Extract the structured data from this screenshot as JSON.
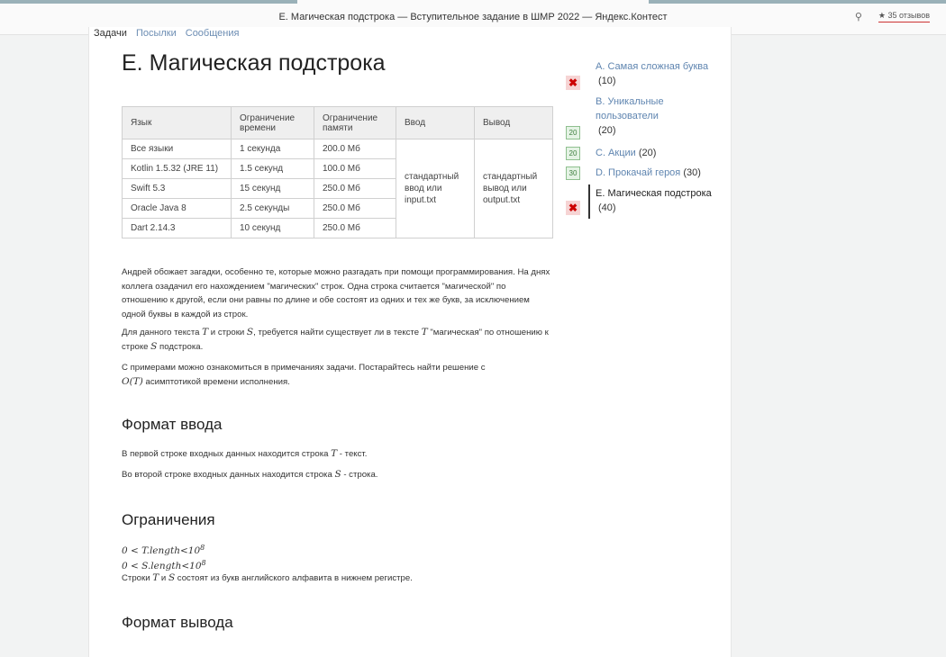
{
  "window": {
    "title": "E. Магическая подстрока — Вступительное задание в ШМР 2022 — Яндекс.Контест",
    "reviews": "★ 35 отзывов",
    "pin_icon": "pin-icon"
  },
  "nav": {
    "items": [
      "Задачи",
      "Посылки",
      "Сообщения"
    ]
  },
  "problem": {
    "title": "E. Магическая подстрока"
  },
  "limits_table": {
    "headers": [
      "Язык",
      "Ограничение времени",
      "Ограничение памяти",
      "Ввод",
      "Вывод"
    ],
    "rows": [
      {
        "lang": "Все языки",
        "time": "1 секунда",
        "memory": "200.0 Мб"
      },
      {
        "lang": "Kotlin 1.5.32 (JRE 11)",
        "time": "1.5 секунд",
        "memory": "100.0 Мб"
      },
      {
        "lang": "Swift 5.3",
        "time": "15 секунд",
        "memory": "250.0 Мб"
      },
      {
        "lang": "Oracle Java 8",
        "time": "2.5 секунды",
        "memory": "250.0 Мб"
      },
      {
        "lang": "Dart 2.14.3",
        "time": "10 секунд",
        "memory": "250.0 Мб"
      }
    ],
    "input": "стандартный ввод или input.txt",
    "output": "стандартный вывод или output.txt"
  },
  "statement": {
    "p1": "Андрей обожает загадки, особенно те, которые можно разгадать при помощи программирования. На днях коллега озадачил его нахождением \"магических\" строк. Одна строка считается \"магической\" по отношению к другой, если они равны по длине и обе состоят из одних и тех же букв, за исключением одной буквы в каждой из строк.",
    "p2_a": "Для данного текста ",
    "T": "T",
    "p2_b": " и строки ",
    "S": "S",
    "p2_c": ", требуется найти существует ли в тексте ",
    "p2_d": " \"магическая\" по отношению к строке ",
    "p2_e": " подстрока.",
    "p3_a": "С примерами можно ознакомиться в примечаниях задачи. Постарайтесь найти решение с",
    "OT": "O(T)",
    "p3_b": " асимптотикой времени исполнения."
  },
  "input_format": {
    "heading": "Формат ввода",
    "line1_a": "В первой строке входных данных находится строка ",
    "line1_b": " - текст.",
    "line2_a": "Во второй строке входных данных находится строка ",
    "line2_b": " - строка."
  },
  "constraints": {
    "heading": "Ограничения",
    "c1": "0 < T.length<10",
    "c2": "0 < S.length<10",
    "exp": "8",
    "note_a": "Строки ",
    "note_b": " и ",
    "note_c": " состоят из букв английского алфавита в нижнем регистре."
  },
  "output_format": {
    "heading": "Формат вывода"
  },
  "problems": [
    {
      "status": "fail",
      "badge": "✖",
      "title": "A. Самая сложная буква",
      "points": "(10)"
    },
    {
      "status": "none",
      "badge": "",
      "title": "B. Уникальные пользователи",
      "points": "(20)"
    },
    {
      "status": "ok",
      "badge": "20",
      "title": "C. Акции",
      "points": "(20)"
    },
    {
      "status": "ok",
      "badge": "30",
      "title": "D. Прокачай героя",
      "points": "(30)"
    },
    {
      "status": "fail",
      "badge": "✖",
      "title": "E. Магическая подстрока",
      "points": "(40)"
    }
  ]
}
